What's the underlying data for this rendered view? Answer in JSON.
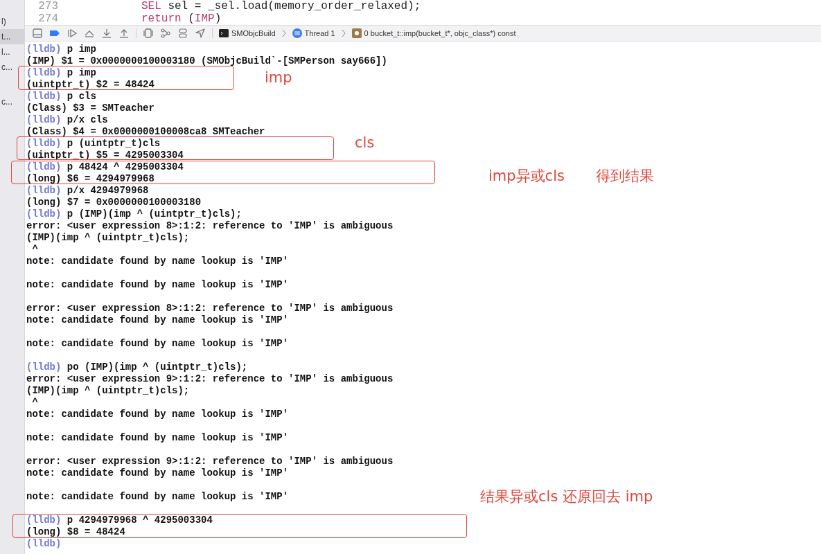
{
  "sidebar": {
    "items": [
      {
        "label": "l)",
        "selected": false
      },
      {
        "label": "t...",
        "selected": true
      },
      {
        "label": "l...",
        "selected": false
      },
      {
        "label": "c...",
        "selected": false
      },
      {
        "label": "c...",
        "selected": false
      }
    ]
  },
  "editor": {
    "lines": [
      {
        "number": "273",
        "tokens": [
          {
            "text": "SEL",
            "kind": "keyword"
          },
          {
            "text": " sel = _sel.load(memory_order_relaxed);",
            "kind": "plain"
          }
        ]
      },
      {
        "number": "274",
        "tokens": [
          {
            "text": "return",
            "kind": "keyword"
          },
          {
            "text": " (",
            "kind": "plain"
          },
          {
            "text": "IMP",
            "kind": "keyword"
          },
          {
            "text": ")",
            "kind": "plain"
          }
        ]
      }
    ]
  },
  "toolbar": {
    "breadcrumbs": [
      {
        "label": "SMObjcBuild",
        "kind": "target"
      },
      {
        "label": "Thread 1",
        "kind": "thread"
      },
      {
        "label": "0 bucket_t::imp(bucket_t*, objc_class*) const",
        "kind": "frame"
      }
    ]
  },
  "console": {
    "lines": [
      {
        "kind": "prompt",
        "prompt": "(lldb)",
        "text": "p imp"
      },
      {
        "kind": "output",
        "text": "(IMP) $1 = 0x0000000100003180 (SMObjcBuild`-[SMPerson say666])"
      },
      {
        "kind": "prompt",
        "prompt": "(lldb)",
        "text": "p imp"
      },
      {
        "kind": "output",
        "text": "(uintptr_t) $2 = 48424"
      },
      {
        "kind": "prompt",
        "prompt": "(lldb)",
        "text": "p cls"
      },
      {
        "kind": "output",
        "text": "(Class) $3 = SMTeacher"
      },
      {
        "kind": "prompt",
        "prompt": "(lldb)",
        "text": "p/x cls"
      },
      {
        "kind": "output",
        "text": "(Class) $4 = 0x0000000100008ca8 SMTeacher"
      },
      {
        "kind": "prompt",
        "prompt": "(lldb)",
        "text": "p (uintptr_t)cls"
      },
      {
        "kind": "output",
        "text": "(uintptr_t) $5 = 4295003304"
      },
      {
        "kind": "prompt",
        "prompt": "(lldb)",
        "text": "p 48424 ^ 4295003304"
      },
      {
        "kind": "output",
        "text": "(long) $6 = 4294979968"
      },
      {
        "kind": "prompt",
        "prompt": "(lldb)",
        "text": "p/x 4294979968"
      },
      {
        "kind": "output",
        "text": "(long) $7 = 0x0000000100003180"
      },
      {
        "kind": "prompt",
        "prompt": "(lldb)",
        "text": "p (IMP)(imp ^ (uintptr_t)cls);"
      },
      {
        "kind": "output",
        "text": "error: <user expression 8>:1:2: reference to 'IMP' is ambiguous"
      },
      {
        "kind": "output",
        "text": "(IMP)(imp ^ (uintptr_t)cls);"
      },
      {
        "kind": "output",
        "text": " ^"
      },
      {
        "kind": "output",
        "text": "note: candidate found by name lookup is 'IMP'"
      },
      {
        "kind": "blank"
      },
      {
        "kind": "output",
        "text": "note: candidate found by name lookup is 'IMP'"
      },
      {
        "kind": "blank"
      },
      {
        "kind": "output",
        "text": "error: <user expression 8>:1:2: reference to 'IMP' is ambiguous"
      },
      {
        "kind": "output",
        "text": "note: candidate found by name lookup is 'IMP'"
      },
      {
        "kind": "blank"
      },
      {
        "kind": "output",
        "text": "note: candidate found by name lookup is 'IMP'"
      },
      {
        "kind": "blank"
      },
      {
        "kind": "prompt",
        "prompt": "(lldb)",
        "text": "po (IMP)(imp ^ (uintptr_t)cls);"
      },
      {
        "kind": "output",
        "text": "error: <user expression 9>:1:2: reference to 'IMP' is ambiguous"
      },
      {
        "kind": "output",
        "text": "(IMP)(imp ^ (uintptr_t)cls);"
      },
      {
        "kind": "output",
        "text": " ^"
      },
      {
        "kind": "output",
        "text": "note: candidate found by name lookup is 'IMP'"
      },
      {
        "kind": "blank"
      },
      {
        "kind": "output",
        "text": "note: candidate found by name lookup is 'IMP'"
      },
      {
        "kind": "blank"
      },
      {
        "kind": "output",
        "text": "error: <user expression 9>:1:2: reference to 'IMP' is ambiguous"
      },
      {
        "kind": "output",
        "text": "note: candidate found by name lookup is 'IMP'"
      },
      {
        "kind": "blank"
      },
      {
        "kind": "output",
        "text": "note: candidate found by name lookup is 'IMP'"
      },
      {
        "kind": "blank"
      },
      {
        "kind": "prompt",
        "prompt": "(lldb)",
        "text": "p 4294979968 ^ 4295003304"
      },
      {
        "kind": "output",
        "text": "(long) $8 = 48424"
      },
      {
        "kind": "prompt",
        "prompt": "(lldb)"
      }
    ]
  },
  "annotations": [
    {
      "labels": [
        "imp"
      ]
    },
    {
      "labels": [
        "cls"
      ]
    },
    {
      "labels": [
        "imp异或cls",
        "得到结果"
      ]
    },
    {
      "labels": [
        "结果异或cls 还原回去 imp"
      ]
    }
  ]
}
